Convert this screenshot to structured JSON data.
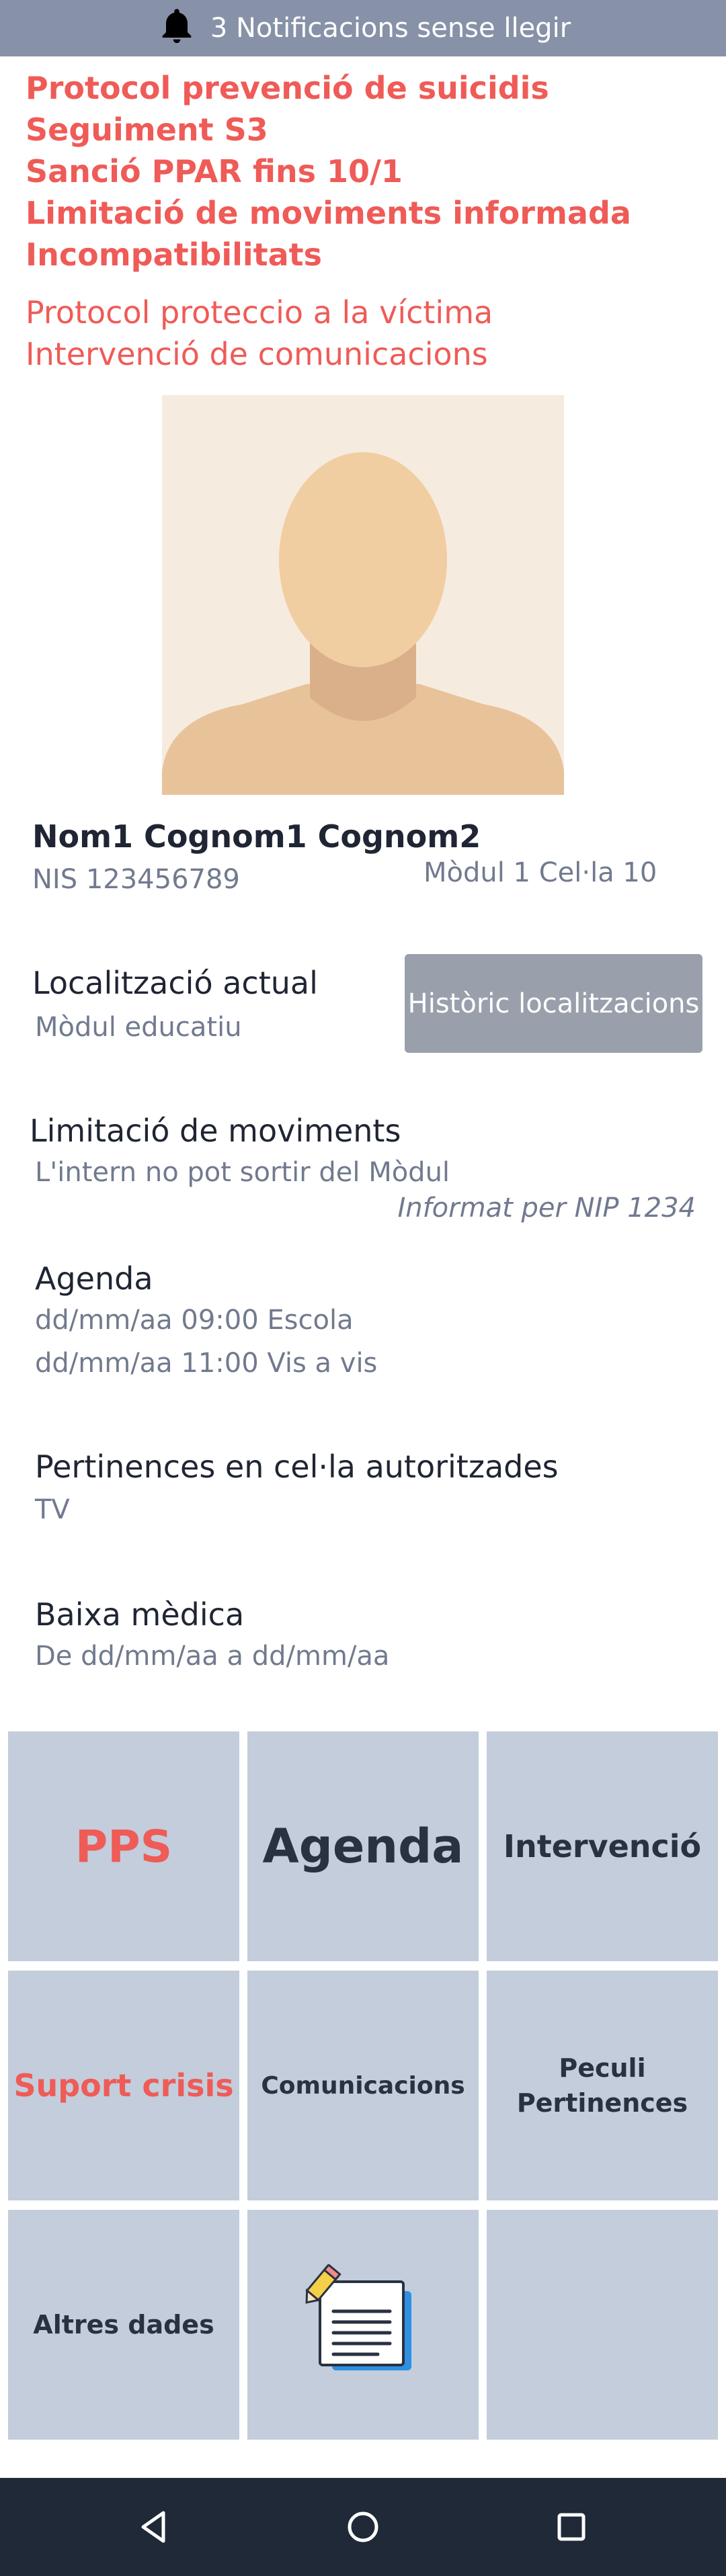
{
  "notification": {
    "icon": "bell-icon",
    "text": "3 Notificacions sense llegir"
  },
  "alerts_bold": [
    "Protocol prevenció de suicidis",
    "Seguiment S3",
    "Sanció PPAR fins 10/1",
    "Limitació de moviments informada",
    "Incompatibilitats"
  ],
  "alerts_normal": [
    "Protocol proteccio a la víctima",
    "Intervenció de comunicacions"
  ],
  "inmate": {
    "name": "Nom1 Cognom1 Cognom2",
    "nis": "NIS 123456789",
    "modul": "Mòdul 1 Cel·la 10"
  },
  "location": {
    "title": "Localització actual",
    "value": "Mòdul educatiu",
    "history_button": "Històric localitzacions"
  },
  "movement": {
    "title": "Limitació de moviments",
    "value": "L'intern no pot sortir del Mòdul",
    "informed_by": "Informat per NIP 1234"
  },
  "agenda": {
    "title": "Agenda",
    "items": [
      "dd/mm/aa 09:00 Escola",
      "dd/mm/aa 11:00 Vis a vis"
    ]
  },
  "belongings": {
    "title": "Pertinences en cel·la autoritzades",
    "value": "TV"
  },
  "sick_leave": {
    "title": "Baixa mèdica",
    "value": "De dd/mm/aa a dd/mm/aa"
  },
  "menu": {
    "pps": "PPS",
    "agenda": "Agenda",
    "intervencio": "Intervenció",
    "suport_crisis": "Suport crisis",
    "comunicacions": "Comunicacions",
    "peculi_line1": "Peculi",
    "peculi_line2": "Pertinences",
    "altres_dades": "Altres dades",
    "notes_icon": "notes-document-icon"
  },
  "colors": {
    "alert": "#ef5b57",
    "notification_bar": "#8792a8",
    "tile": "#c3cddb",
    "button": "#99a0ac",
    "navbar": "#1f2937"
  },
  "navbar": {
    "icons": [
      "back-icon",
      "home-icon",
      "recents-icon"
    ]
  }
}
